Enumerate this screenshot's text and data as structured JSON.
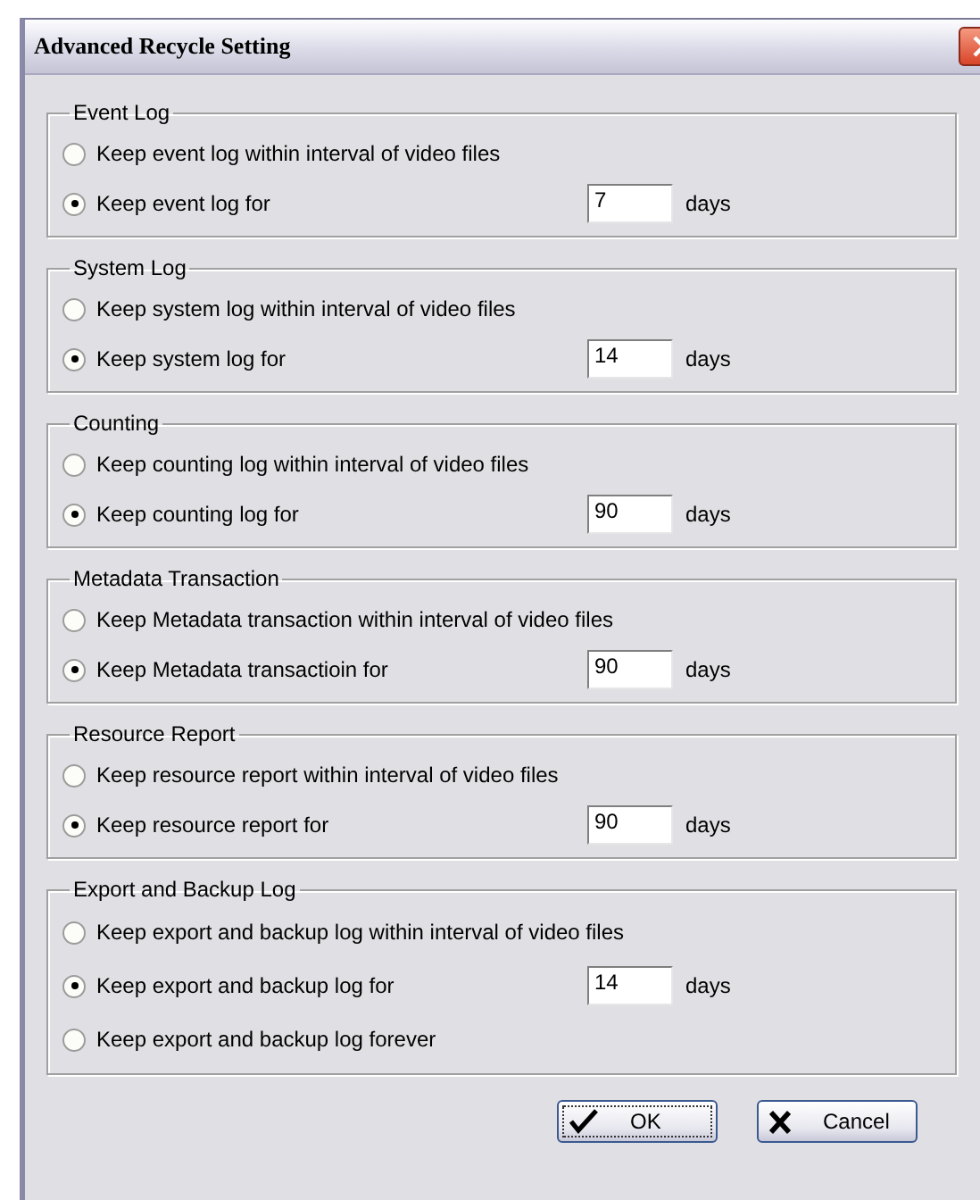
{
  "window": {
    "title": "Advanced Recycle Setting"
  },
  "groups": [
    {
      "label": "Event Log",
      "options": [
        {
          "kind": "plain",
          "label": "Keep event log within interval of video files",
          "selected": false
        },
        {
          "kind": "days",
          "label": "Keep event log for",
          "selected": true,
          "value": "7",
          "unit": "days"
        }
      ]
    },
    {
      "label": "System Log",
      "options": [
        {
          "kind": "plain",
          "label": "Keep system log within interval of video files",
          "selected": false
        },
        {
          "kind": "days",
          "label": "Keep system log for",
          "selected": true,
          "value": "14",
          "unit": "days"
        }
      ]
    },
    {
      "label": "Counting",
      "options": [
        {
          "kind": "plain",
          "label": "Keep counting log within interval of video files",
          "selected": false
        },
        {
          "kind": "days",
          "label": "Keep counting log for",
          "selected": true,
          "value": "90",
          "unit": "days"
        }
      ]
    },
    {
      "label": "Metadata Transaction",
      "options": [
        {
          "kind": "plain",
          "label": "Keep Metadata transaction within interval of video files",
          "selected": false
        },
        {
          "kind": "days",
          "label": "Keep Metadata transactioin for",
          "selected": true,
          "value": "90",
          "unit": "days"
        }
      ]
    },
    {
      "label": "Resource Report",
      "options": [
        {
          "kind": "plain",
          "label": "Keep resource report within interval of video files",
          "selected": false
        },
        {
          "kind": "days",
          "label": "Keep resource report for",
          "selected": true,
          "value": "90",
          "unit": "days"
        }
      ]
    },
    {
      "label": "Export and Backup Log",
      "options": [
        {
          "kind": "plain",
          "label": "Keep export and backup log within interval of video files",
          "selected": false
        },
        {
          "kind": "days",
          "label": "Keep export and backup log for",
          "selected": true,
          "value": "14",
          "unit": "days"
        },
        {
          "kind": "plain",
          "label": "Keep export and backup log forever",
          "selected": false
        }
      ]
    }
  ],
  "buttons": [
    {
      "kind": "ok",
      "label": "OK"
    },
    {
      "kind": "cancel",
      "label": "Cancel"
    }
  ]
}
